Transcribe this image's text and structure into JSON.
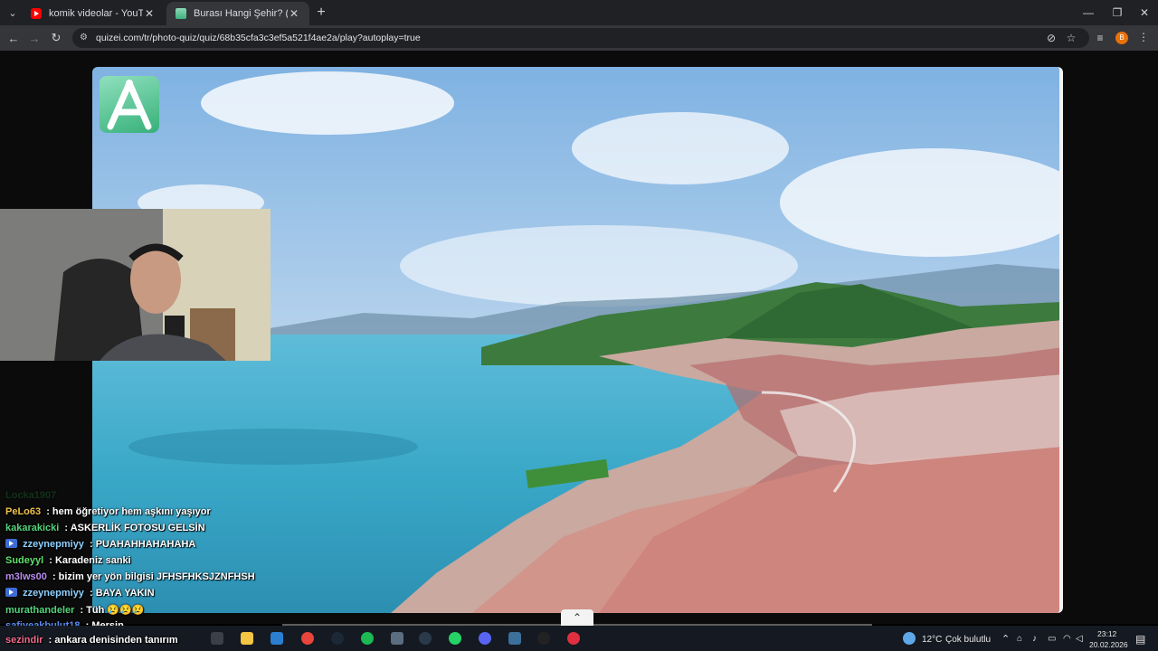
{
  "browser": {
    "tabs": [
      {
        "title": "komik videolar - YouTube",
        "active": false,
        "favicon": "youtube-icon"
      },
      {
        "title": "Burası Hangi Şehir? (Türkiye) - Q",
        "active": true,
        "favicon": "quizei-icon"
      }
    ],
    "url": "quizei.com/tr/photo-quiz/quiz/68b35cfa3c3ef5a521f4ae2a/play?autoplay=true",
    "profile_initial": "B"
  },
  "chat": {
    "messages": [
      {
        "user": "Locka1907",
        "text": "",
        "color": "#1e7a38",
        "badge": false,
        "faded": true
      },
      {
        "user": "PeLo63",
        "text": ": hem öğretiyor hem aşkını yaşıyor",
        "color": "#f0c24a",
        "badge": false
      },
      {
        "user": "kakarakicki",
        "text": ": ASKERLİK FOTOSU GELSİN",
        "color": "#52d47a",
        "badge": false
      },
      {
        "user": "zzeynepmiyy",
        "text": ": PUAHAHHAHAHAHA",
        "color": "#8fd0ff",
        "badge": true
      },
      {
        "user": "Sudeyyl",
        "text": ": Karadeniz sanki",
        "color": "#5ee06a",
        "badge": false
      },
      {
        "user": "m3lws00",
        "text": ": bizim yer yön bilgisi JFHSFHKSJZNFHSH",
        "color": "#b98cf0",
        "badge": false
      },
      {
        "user": "zzeynepmiyy",
        "text": ": BAYA YAKIN",
        "color": "#8fd0ff",
        "badge": true
      },
      {
        "user": "murathandeler",
        "text": ": Tüh 😢😢😢",
        "color": "#52d47a",
        "badge": false
      },
      {
        "user": "safiyeakbulut18",
        "text": ": Mersin",
        "color": "#5a8cf0",
        "badge": false
      },
      {
        "user": "sezindir",
        "text": ": ankara denisinden tanırım",
        "color": "#f06a8a",
        "badge": false
      }
    ]
  },
  "taskbar": {
    "weather_temp": "12°C",
    "weather_text": "Çok bulutlu",
    "time": "23:12",
    "date": "20.02.2026"
  },
  "colors": {
    "accent_green": "#3fb27f",
    "tab_bg": "#1f2125",
    "toolbar_bg": "#35363a"
  }
}
